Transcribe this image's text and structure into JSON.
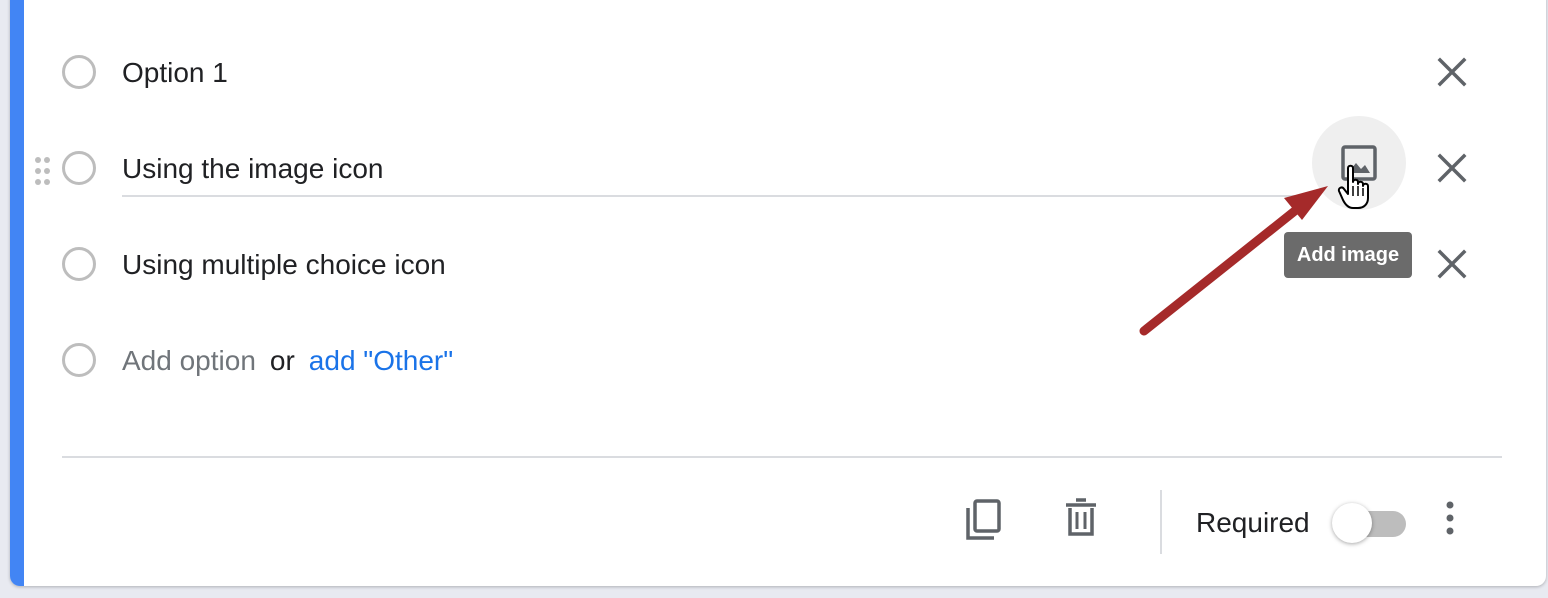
{
  "options": [
    {
      "label": "Option 1"
    },
    {
      "label": "Using the image icon"
    },
    {
      "label": "Using multiple choice icon"
    }
  ],
  "add_option": {
    "label": "Add option",
    "or": "or",
    "other_link": "add \"Other\""
  },
  "tooltip": {
    "text": "Add image"
  },
  "footer": {
    "required_label": "Required",
    "required_on": false
  },
  "icons": {
    "remove": "close-icon",
    "image": "image-icon",
    "drag": "drag-handle-icon",
    "copy": "copy-icon",
    "delete": "trash-icon",
    "more": "more-vert-icon",
    "cursor": "hand-pointer-icon"
  },
  "colors": {
    "accent": "#4285f4",
    "link": "#1a73e8",
    "annotation_arrow": "#a52a2a",
    "tooltip_bg": "#6b6b6b"
  }
}
